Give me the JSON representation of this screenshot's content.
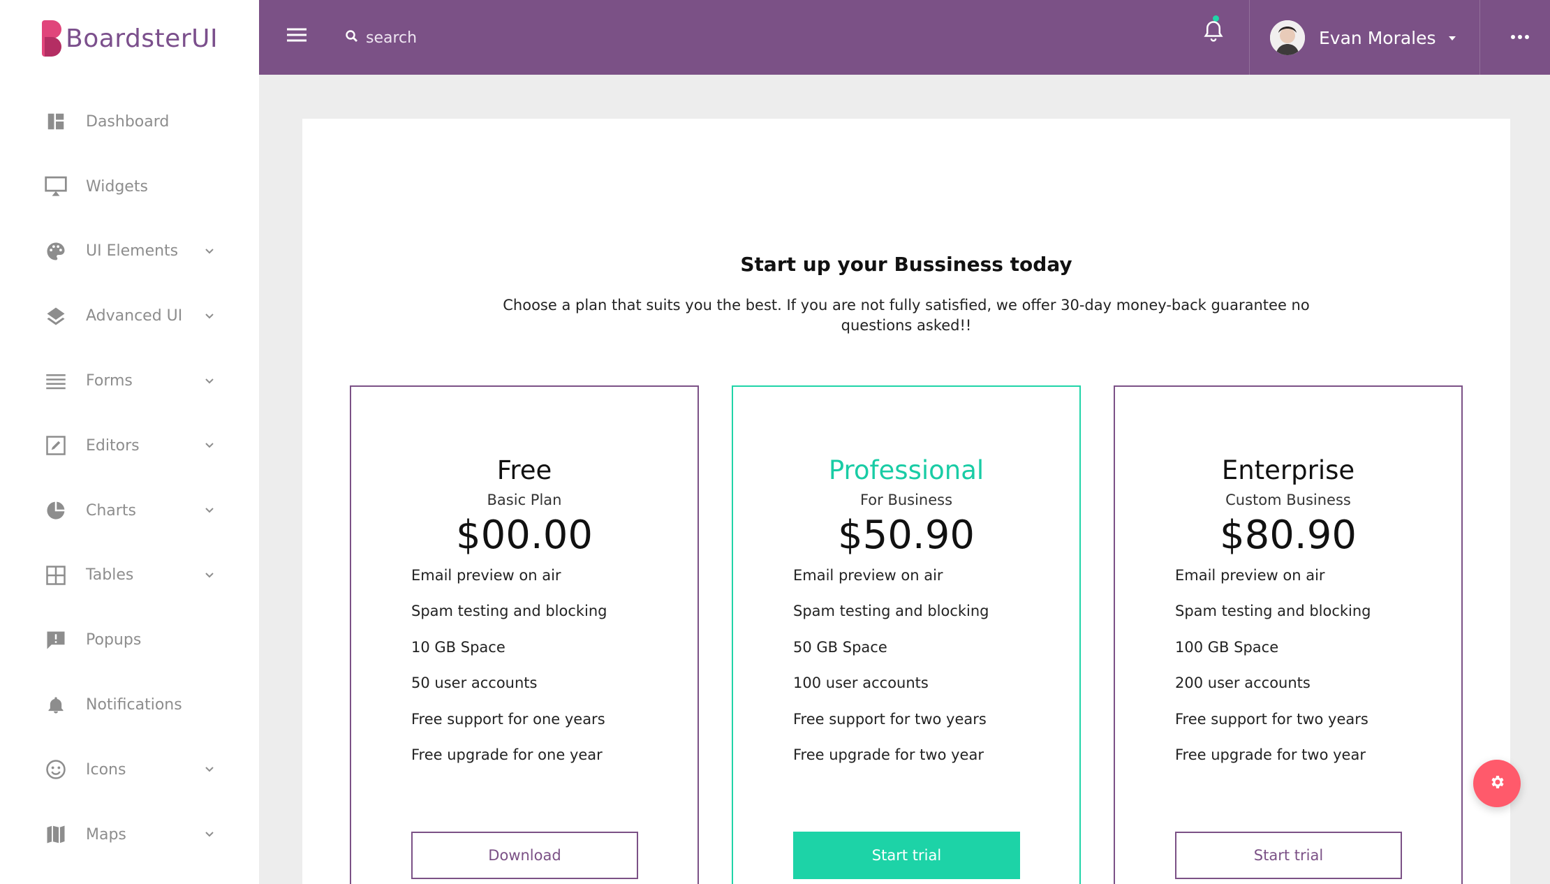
{
  "brand": {
    "name": "BoardsterUI"
  },
  "sidebar": {
    "items": [
      {
        "label": "Dashboard",
        "icon": "dashboard-icon",
        "has_submenu": false
      },
      {
        "label": "Widgets",
        "icon": "monitor-icon",
        "has_submenu": false
      },
      {
        "label": "UI Elements",
        "icon": "palette-icon",
        "has_submenu": true
      },
      {
        "label": "Advanced UI",
        "icon": "layers-icon",
        "has_submenu": true
      },
      {
        "label": "Forms",
        "icon": "list-icon",
        "has_submenu": true
      },
      {
        "label": "Editors",
        "icon": "edit-icon",
        "has_submenu": true
      },
      {
        "label": "Charts",
        "icon": "pie-chart-icon",
        "has_submenu": true
      },
      {
        "label": "Tables",
        "icon": "grid-icon",
        "has_submenu": true
      },
      {
        "label": "Popups",
        "icon": "message-alert-icon",
        "has_submenu": false
      },
      {
        "label": "Notifications",
        "icon": "bell-icon",
        "has_submenu": false
      },
      {
        "label": "Icons",
        "icon": "smile-icon",
        "has_submenu": true
      },
      {
        "label": "Maps",
        "icon": "map-icon",
        "has_submenu": true
      }
    ]
  },
  "header": {
    "search_placeholder": "search",
    "user_name": "Evan Morales"
  },
  "pricing": {
    "title": "Start up your Bussiness today",
    "subtitle": "Choose a plan that suits you the best. If you are not fully satisfied, we offer 30-day money-back guarantee no questions asked!!",
    "plans": [
      {
        "name": "Free",
        "tagline": "Basic Plan",
        "price": "$00.00",
        "features": [
          "Email preview on air",
          "Spam testing and blocking",
          "10 GB Space",
          "50 user accounts",
          "Free support for one years",
          "Free upgrade for one year"
        ],
        "button": "Download"
      },
      {
        "name": "Professional",
        "tagline": "For Business",
        "price": "$50.90",
        "features": [
          "Email preview on air",
          "Spam testing and blocking",
          "50 GB Space",
          "100 user accounts",
          "Free support for two years",
          "Free upgrade for two year"
        ],
        "button": "Start trial"
      },
      {
        "name": "Enterprise",
        "tagline": "Custom Business",
        "price": "$80.90",
        "features": [
          "Email preview on air",
          "Spam testing and blocking",
          "100 GB Space",
          "200 user accounts",
          "Free support for two years",
          "Free upgrade for two year"
        ],
        "button": "Start trial"
      }
    ]
  },
  "colors": {
    "primary": "#7b5186",
    "accent": "#20d4a8",
    "brand_pink": "#e0457b",
    "fab": "#ff5a6b"
  }
}
